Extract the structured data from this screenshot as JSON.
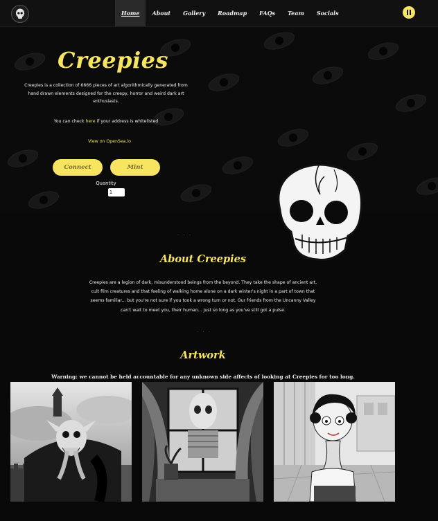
{
  "nav": {
    "items": [
      {
        "label": "Home",
        "active": true
      },
      {
        "label": "About"
      },
      {
        "label": "Gallery"
      },
      {
        "label": "Roadmap"
      },
      {
        "label": "FAQs"
      },
      {
        "label": "Team"
      },
      {
        "label": "Socials"
      }
    ]
  },
  "hero": {
    "title": "Creepies",
    "description": "Creepies is a collection of 6666 pieces of art algorithmically generated from hand drawn elements designed for the creepy, horror and weird dark art enthusiasts.",
    "check_prefix": "You can check ",
    "check_link": "here",
    "check_suffix": " if your address is whitelisted",
    "opensea_link": "View on OpenSea.io",
    "connect_label": "Connect",
    "mint_label": "Mint",
    "quantity_label": "Quantity",
    "quantity_value": "1"
  },
  "about": {
    "title": "About Creepies",
    "text": "Creepies are a legion of dark, misunderstood beings from the beyond. They take the shape of ancient art, cult film creatures and that feeling of walking home alone on a dark winter's night in a part of town that seems familiar... but you're not sure if you took a wrong turn or not. Our friends from the Uncanny Valley can't wait to meet you, their human... just so long as you've still got a pulse."
  },
  "artwork": {
    "title": "Artwork",
    "warning": "Warning: we cannot be held accountable for any unknown side affects of looking at Creepies for too long."
  },
  "colors": {
    "accent": "#f7e461",
    "background": "#070707",
    "nav": "#111111"
  },
  "icons": [
    "skull-logo-icon",
    "pause-icon",
    "skull-illustration"
  ]
}
